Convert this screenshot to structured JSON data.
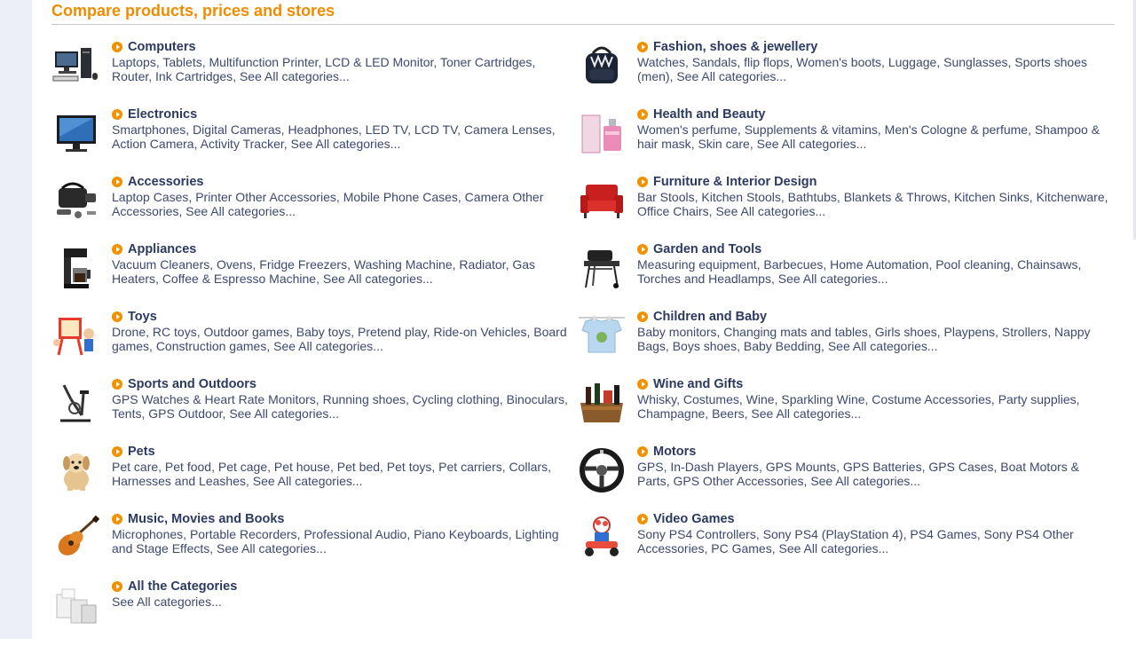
{
  "page": {
    "title": "Compare products, prices and stores",
    "accent_color": "#f08c00",
    "link_color": "#2c3a63"
  },
  "categories": [
    {
      "title": "Computers",
      "links": [
        "Laptops",
        "Tablets",
        "Multifunction Printer",
        "LCD & LED Monitor",
        "Toner Cartridges",
        "Router",
        "Ink Cartridges"
      ],
      "see_all": "See All categories...",
      "icon": "computer-icon"
    },
    {
      "title": "Fashion, shoes & jewellery",
      "links": [
        "Watches",
        "Sandals",
        "flip flops",
        "Women's boots",
        "Luggage",
        "Sunglasses",
        "Sports shoes (men)"
      ],
      "see_all": "See All categories...",
      "icon": "backpack-icon"
    },
    {
      "title": "Electronics",
      "links": [
        "Smartphones",
        "Digital Cameras",
        "Headphones",
        "LED TV",
        "LCD TV",
        "Camera Lenses",
        "Action Camera",
        "Activity Tracker"
      ],
      "see_all": "See All categories...",
      "icon": "tv-icon"
    },
    {
      "title": "Health and Beauty",
      "links": [
        "Women's perfume",
        "Supplements & vitamins",
        "Men's Cologne & perfume",
        "Shampoo & hair mask",
        "Skin care"
      ],
      "see_all": "See All categories...",
      "icon": "perfume-icon"
    },
    {
      "title": "Accessories",
      "links": [
        "Laptop Cases",
        "Printer Other Accessories",
        "Mobile Phone Cases",
        "Camera Other Accessories"
      ],
      "see_all": "See All categories...",
      "icon": "camera-bag-icon"
    },
    {
      "title": "Furniture & Interior Design",
      "links": [
        "Bar Stools",
        "Kitchen Stools",
        "Bathtubs",
        "Blankets & Throws",
        "Kitchen Sinks",
        "Kitchenware",
        "Office Chairs"
      ],
      "see_all": "See All categories...",
      "icon": "armchair-icon"
    },
    {
      "title": "Appliances",
      "links": [
        "Vacuum Cleaners",
        "Ovens",
        "Fridge Freezers",
        "Washing Machine",
        "Radiator",
        "Gas Heaters",
        "Coffee & Espresso Machine"
      ],
      "see_all": "See All categories...",
      "icon": "coffee-maker-icon"
    },
    {
      "title": "Garden and Tools",
      "links": [
        "Measuring equipment",
        "Barbecues",
        "Home Automation",
        "Pool cleaning",
        "Chainsaws",
        "Torches and Headlamps"
      ],
      "see_all": "See All categories...",
      "icon": "barbecue-icon"
    },
    {
      "title": "Toys",
      "links": [
        "Drone",
        "RC toys",
        "Outdoor games",
        "Baby toys",
        "Pretend play",
        "Ride-on Vehicles",
        "Board games",
        "Construction games"
      ],
      "see_all": "See All categories...",
      "icon": "toys-icon"
    },
    {
      "title": "Children and Baby",
      "links": [
        "Baby monitors",
        "Changing mats and tables",
        "Girls shoes",
        "Playpens",
        "Strollers",
        "Nappy Bags",
        "Boys shoes",
        "Baby Bedding"
      ],
      "see_all": "See All categories...",
      "icon": "baby-shirt-icon"
    },
    {
      "title": "Sports and Outdoors",
      "links": [
        "GPS Watches & Heart Rate Monitors",
        "Running shoes",
        "Cycling clothing",
        "Binoculars",
        "Tents",
        "GPS Outdoor"
      ],
      "see_all": "See All categories...",
      "icon": "exercise-bike-icon"
    },
    {
      "title": "Wine and Gifts",
      "links": [
        "Whisky",
        "Costumes",
        "Wine",
        "Sparkling Wine",
        "Costume Accessories",
        "Party supplies",
        "Champagne",
        "Beers"
      ],
      "see_all": "See All categories...",
      "icon": "gift-basket-icon"
    },
    {
      "title": "Pets",
      "links": [
        "Pet care",
        "Pet food",
        "Pet cage",
        "Pet house",
        "Pet bed",
        "Pet toys",
        "Pet carriers",
        "Collars",
        "Harnesses and Leashes"
      ],
      "see_all": "See All categories...",
      "icon": "puppy-icon"
    },
    {
      "title": "Motors",
      "links": [
        "GPS",
        "In-Dash Players",
        "GPS Mounts",
        "GPS Batteries",
        "GPS Cases",
        "Boat Motors & Parts",
        "GPS Other Accessories"
      ],
      "see_all": "See All categories...",
      "icon": "steering-wheel-icon"
    },
    {
      "title": "Music, Movies and Books",
      "links": [
        "Microphones",
        "Portable Recorders",
        "Professional Audio",
        "Piano Keyboards",
        "Lighting and Stage Effects"
      ],
      "see_all": "See All categories...",
      "icon": "guitar-icon"
    },
    {
      "title": "Video Games",
      "links": [
        "Sony PS4 Controllers",
        "Sony PS4 (PlayStation 4)",
        "PS4 Games",
        "Sony PS4 Other Accessories",
        "PC Games"
      ],
      "see_all": "See All categories...",
      "icon": "kart-racer-icon"
    },
    {
      "title": "All the Categories",
      "links": [],
      "see_all": "See All categories...",
      "icon": "boxes-icon"
    }
  ]
}
